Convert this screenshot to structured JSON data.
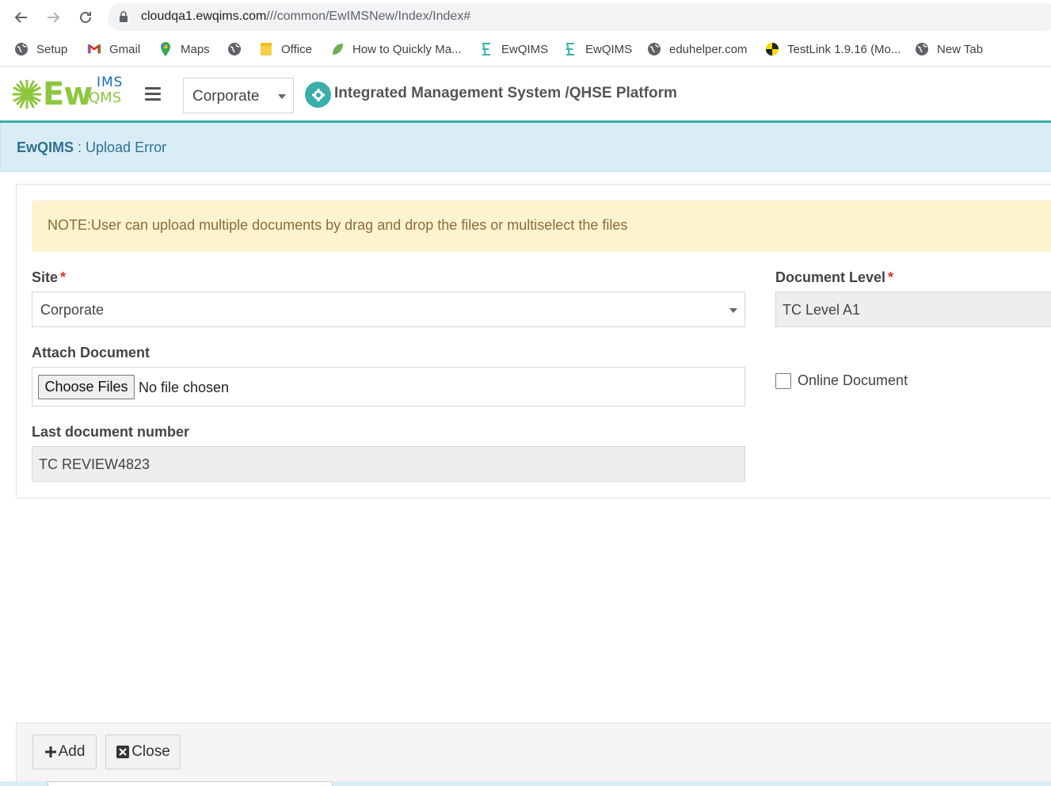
{
  "browser": {
    "url_host": "cloudqa1.ewqims.com",
    "url_path": "///common/EwIMSNew/Index/Index#",
    "bookmarks": [
      {
        "label": "Setup",
        "icon": "globe-icon"
      },
      {
        "label": "Gmail",
        "icon": "gmail-icon"
      },
      {
        "label": "Maps",
        "icon": "maps-icon"
      },
      {
        "label": "",
        "icon": "globe-icon"
      },
      {
        "label": "Office",
        "icon": "folder-icon"
      },
      {
        "label": "How to Quickly Ma...",
        "icon": "leaf-icon"
      },
      {
        "label": "EwQIMS",
        "icon": "ewqims-icon"
      },
      {
        "label": "EwQIMS",
        "icon": "ewqims-icon"
      },
      {
        "label": "eduhelper.com",
        "icon": "globe-icon"
      },
      {
        "label": "TestLink 1.9.16 (Mo...",
        "icon": "testlink-icon"
      },
      {
        "label": "New Tab",
        "icon": "globe-icon"
      }
    ]
  },
  "header": {
    "logo_text": "Ew",
    "logo_top": "IMS",
    "logo_bottom": "QMS",
    "site_selected": "Corporate",
    "platform_title": "Integrated Management System /QHSE Platform"
  },
  "banner": {
    "app": "EwQIMS",
    "separator": " : ",
    "page": "Upload Error"
  },
  "form": {
    "note": "NOTE:User can upload multiple documents by drag and drop the files or multiselect the files",
    "site_label": "Site",
    "site_value": "Corporate",
    "doc_level_label": "Document Level",
    "doc_level_value": "TC Level A1",
    "attach_label": "Attach Document",
    "choose_files": "Choose Files",
    "no_file": "No file chosen",
    "online_doc_label": "Online Document",
    "last_doc_label": "Last document number",
    "last_doc_value": "TC REVIEW4823",
    "required_mark": "*"
  },
  "footer": {
    "add_label": "Add",
    "close_label": "Close"
  },
  "colors": {
    "accent": "#3aafa9",
    "banner_bg": "#d9edf7",
    "note_bg": "#fcf3cf",
    "required": "#d9332b"
  }
}
